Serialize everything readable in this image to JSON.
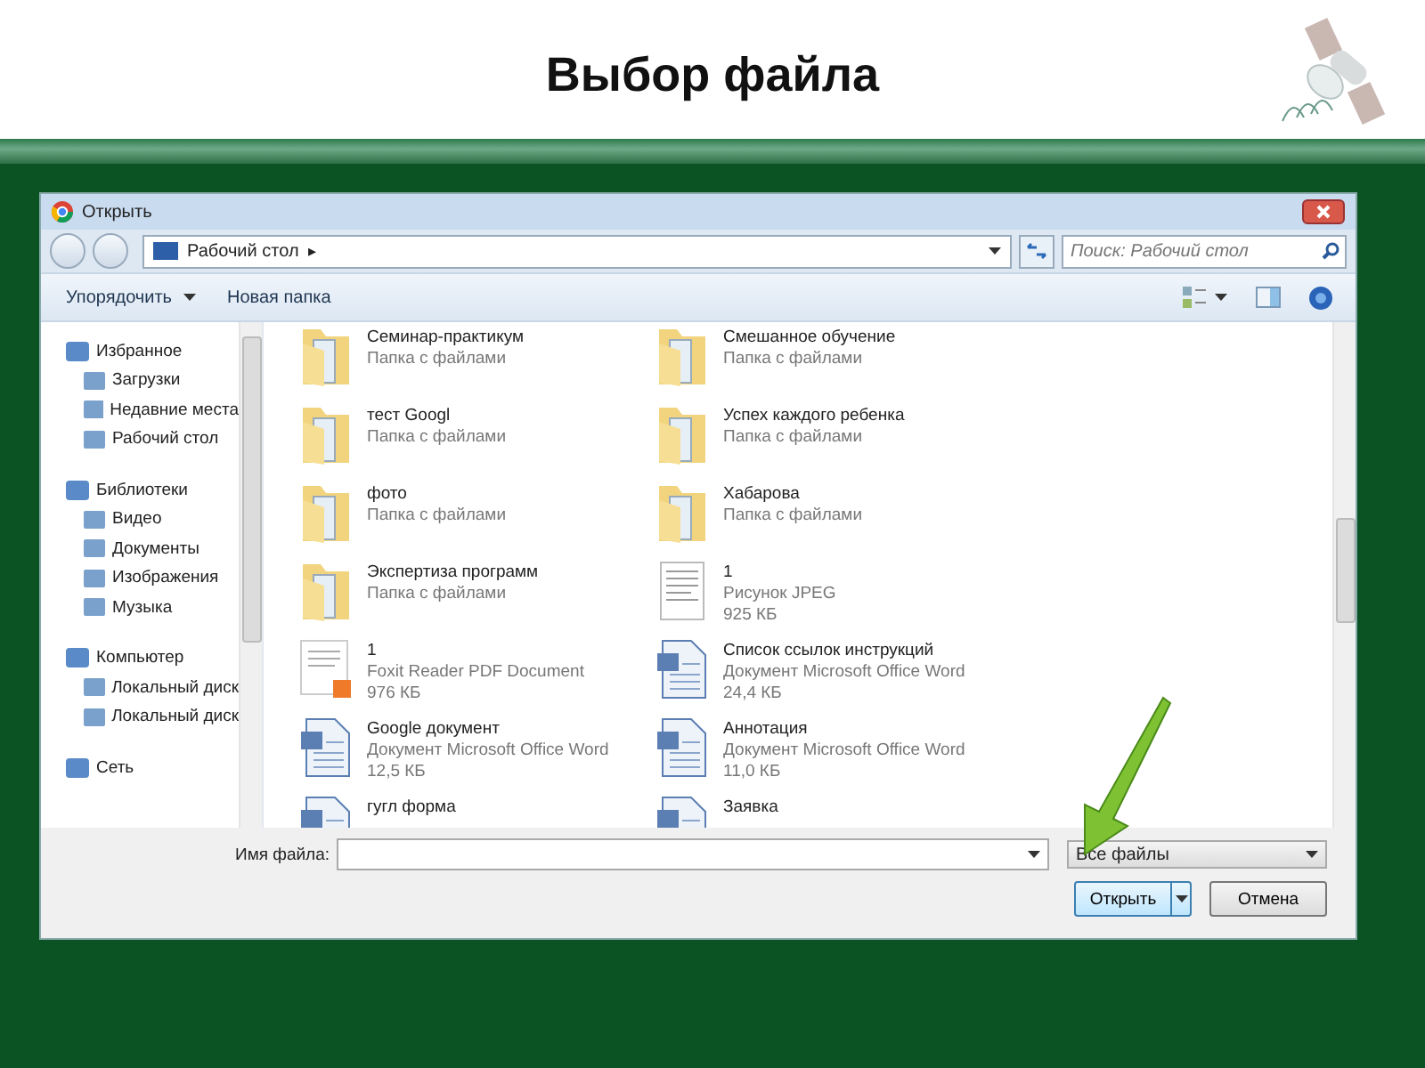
{
  "slide": {
    "title": "Выбор файла"
  },
  "dialog": {
    "title": "Открыть",
    "address": {
      "location": "Рабочий стол",
      "separator": "▸"
    },
    "search": {
      "placeholder": "Поиск: Рабочий стол"
    },
    "toolbar": [
      {
        "label": "Упорядочить",
        "dropdown": true
      },
      {
        "label": "Новая папка",
        "dropdown": false
      }
    ],
    "sidebar": [
      {
        "label": "Избранное",
        "children": [
          {
            "label": "Загрузки"
          },
          {
            "label": "Недавние места"
          },
          {
            "label": "Рабочий стол"
          }
        ]
      },
      {
        "label": "Библиотеки",
        "children": [
          {
            "label": "Видео"
          },
          {
            "label": "Документы"
          },
          {
            "label": "Изображения"
          },
          {
            "label": "Музыка"
          }
        ]
      },
      {
        "label": "Компьютер",
        "children": [
          {
            "label": "Локальный диск"
          },
          {
            "label": "Локальный диск"
          }
        ]
      },
      {
        "label": "Сеть"
      }
    ],
    "files": [
      {
        "kind": "folder",
        "name": "Семинар-практикум",
        "type": "Папка с файлами"
      },
      {
        "kind": "folder",
        "name": "Смешанное обучение",
        "type": "Папка с файлами"
      },
      {
        "kind": "folder",
        "name": "тест Googl",
        "type": "Папка с файлами"
      },
      {
        "kind": "folder",
        "name": "Успех каждого ребенка",
        "type": "Папка с файлами"
      },
      {
        "kind": "folder",
        "name": "фото",
        "type": "Папка с файлами"
      },
      {
        "kind": "folder",
        "name": "Хабарова",
        "type": "Папка с файлами"
      },
      {
        "kind": "folder",
        "name": "Экспертиза программ",
        "type": "Папка с файлами"
      },
      {
        "kind": "image",
        "name": "1",
        "type": "Рисунок JPEG",
        "size": "925 КБ"
      },
      {
        "kind": "pdf",
        "name": "1",
        "type": "Foxit Reader PDF Document",
        "size": "976 КБ"
      },
      {
        "kind": "document",
        "name": "Список ссылок инструкций",
        "type": "Документ Microsoft Office Word",
        "size": "24,4 КБ"
      },
      {
        "kind": "document",
        "name": "Google документ",
        "type": "Документ Microsoft Office Word",
        "size": "12,5 КБ"
      },
      {
        "kind": "document",
        "name": "Аннотация",
        "type": "Документ Microsoft Office Word",
        "size": "11,0 КБ"
      },
      {
        "kind": "document",
        "name": "гугл форма"
      },
      {
        "kind": "document",
        "name": "Заявка"
      }
    ],
    "filename": {
      "label": "Имя файла:"
    },
    "filter": {
      "value": "Все файлы"
    },
    "buttons": [
      {
        "label": "Открыть",
        "kind": "split"
      },
      {
        "label": "Отмена",
        "kind": "plain"
      }
    ]
  }
}
